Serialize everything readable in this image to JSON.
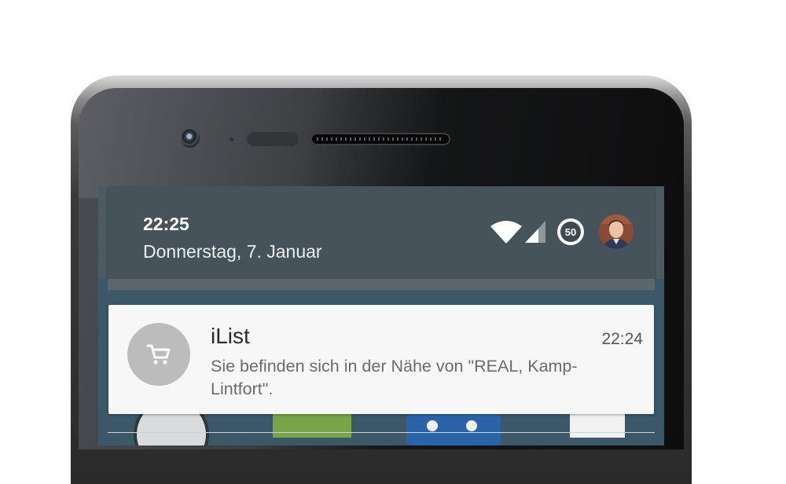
{
  "status_bar": {
    "time": "22:25",
    "date": "Donnerstag, 7. Januar",
    "battery_level": "50",
    "icons": [
      "wifi-icon",
      "cellular-signal-icon",
      "battery-icon",
      "user-avatar"
    ]
  },
  "notification": {
    "app_name": "iList",
    "time": "22:24",
    "message": "Sie befinden sich in der Nähe von \"REAL, Kamp-Lintfort\".",
    "icon": "shopping-cart-icon"
  },
  "colors": {
    "screen_bg": "#3b5768",
    "status_panel": "#46535a",
    "card_bg": "#f7f7f7",
    "icon_circle": "#bcbcbc"
  }
}
